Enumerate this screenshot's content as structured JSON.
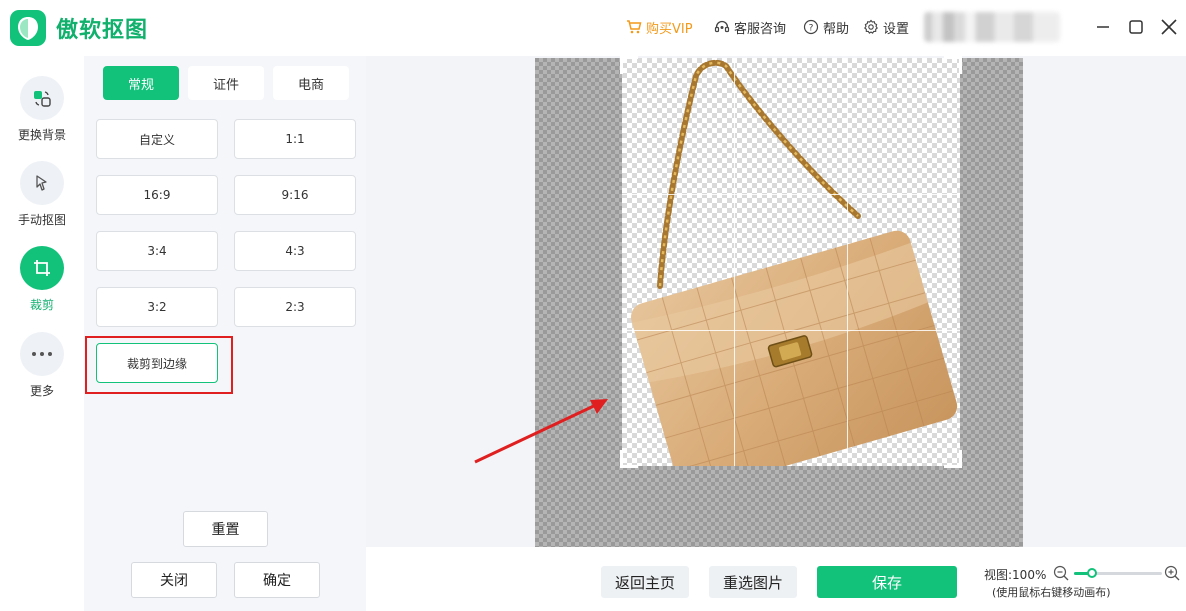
{
  "app": {
    "title": "傲软抠图"
  },
  "titlebar": {
    "buy_vip": "购买VIP",
    "support": "客服咨询",
    "help": "帮助",
    "settings": "设置"
  },
  "rail": {
    "items": [
      {
        "label": "更换背景",
        "icon": "change-background-icon"
      },
      {
        "label": "手动抠图",
        "icon": "manual-cutout-icon"
      },
      {
        "label": "裁剪",
        "icon": "crop-icon",
        "active": true
      },
      {
        "label": "更多",
        "icon": "more-dots-icon"
      }
    ]
  },
  "panel": {
    "tabs": [
      "常规",
      "证件",
      "电商"
    ],
    "active_tab": "常规",
    "ratios": [
      "自定义",
      "1:1",
      "16:9",
      "9:16",
      "3:4",
      "4:3",
      "3:2",
      "2:3"
    ],
    "crop_to_edge": "裁剪到边缘",
    "reset": "重置",
    "close": "关闭",
    "confirm": "确定"
  },
  "bottom": {
    "back_home": "返回主页",
    "reselect": "重选图片",
    "save": "保存",
    "zoom_label": "视图:100%",
    "zoom_hint": "(使用鼠标右键移动画布)",
    "zoom_fraction": 0.2
  },
  "colors": {
    "accent": "#12c27b",
    "vip": "#f39a1b",
    "annotation": "#e02020"
  }
}
